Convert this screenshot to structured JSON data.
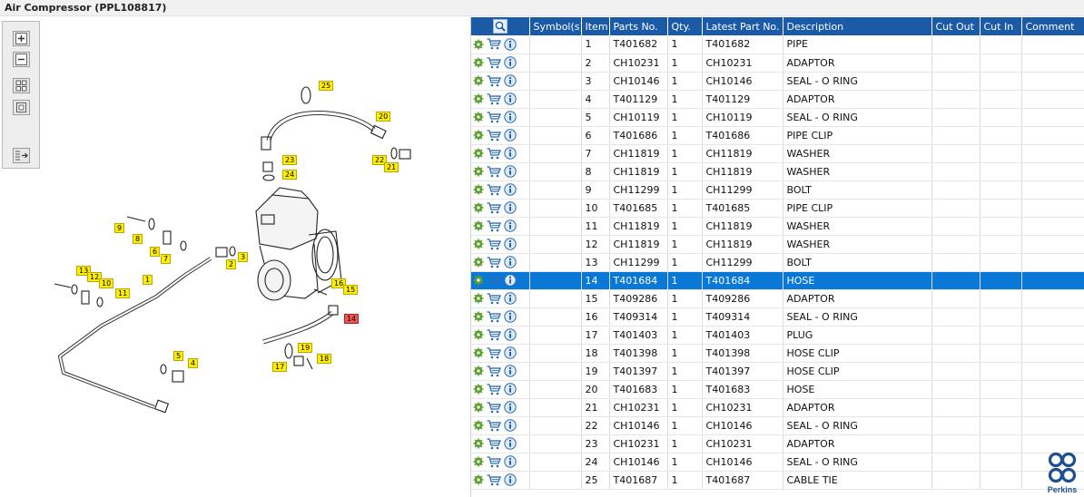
{
  "window": {
    "title": "Air Compressor (PPL108817)"
  },
  "toolbar": {
    "buttons": [
      {
        "name": "zoom-in-icon"
      },
      {
        "name": "zoom-out-icon"
      },
      {
        "name": "fit-all-icon"
      },
      {
        "name": "fit-window-icon"
      },
      {
        "name": "list-export-icon"
      }
    ]
  },
  "grid": {
    "headers": {
      "symbols": "Symbol(s)",
      "item": "Item",
      "parts_no": "Parts No.",
      "qty": "Qty.",
      "latest_part_no": "Latest Part No.",
      "description": "Description",
      "cut_out": "Cut Out",
      "cut_in": "Cut In",
      "comment": "Comment"
    },
    "selected_item": "14",
    "rows": [
      {
        "item": "1",
        "parts_no": "T401682",
        "qty": "1",
        "latest": "T401682",
        "desc": "PIPE"
      },
      {
        "item": "2",
        "parts_no": "CH10231",
        "qty": "1",
        "latest": "CH10231",
        "desc": "ADAPTOR"
      },
      {
        "item": "3",
        "parts_no": "CH10146",
        "qty": "1",
        "latest": "CH10146",
        "desc": "SEAL - O RING"
      },
      {
        "item": "4",
        "parts_no": "T401129",
        "qty": "1",
        "latest": "T401129",
        "desc": "ADAPTOR"
      },
      {
        "item": "5",
        "parts_no": "CH10119",
        "qty": "1",
        "latest": "CH10119",
        "desc": "SEAL - O RING"
      },
      {
        "item": "6",
        "parts_no": "T401686",
        "qty": "1",
        "latest": "T401686",
        "desc": "PIPE CLIP"
      },
      {
        "item": "7",
        "parts_no": "CH11819",
        "qty": "1",
        "latest": "CH11819",
        "desc": "WASHER"
      },
      {
        "item": "8",
        "parts_no": "CH11819",
        "qty": "1",
        "latest": "CH11819",
        "desc": "WASHER"
      },
      {
        "item": "9",
        "parts_no": "CH11299",
        "qty": "1",
        "latest": "CH11299",
        "desc": "BOLT"
      },
      {
        "item": "10",
        "parts_no": "T401685",
        "qty": "1",
        "latest": "T401685",
        "desc": "PIPE CLIP"
      },
      {
        "item": "11",
        "parts_no": "CH11819",
        "qty": "1",
        "latest": "CH11819",
        "desc": "WASHER"
      },
      {
        "item": "12",
        "parts_no": "CH11819",
        "qty": "1",
        "latest": "CH11819",
        "desc": "WASHER"
      },
      {
        "item": "13",
        "parts_no": "CH11299",
        "qty": "1",
        "latest": "CH11299",
        "desc": "BOLT"
      },
      {
        "item": "14",
        "parts_no": "T401684",
        "qty": "1",
        "latest": "T401684",
        "desc": "HOSE"
      },
      {
        "item": "15",
        "parts_no": "T409286",
        "qty": "1",
        "latest": "T409286",
        "desc": "ADAPTOR"
      },
      {
        "item": "16",
        "parts_no": "T409314",
        "qty": "1",
        "latest": "T409314",
        "desc": "SEAL - O RING"
      },
      {
        "item": "17",
        "parts_no": "T401403",
        "qty": "1",
        "latest": "T401403",
        "desc": "PLUG"
      },
      {
        "item": "18",
        "parts_no": "T401398",
        "qty": "1",
        "latest": "T401398",
        "desc": "HOSE CLIP"
      },
      {
        "item": "19",
        "parts_no": "T401397",
        "qty": "1",
        "latest": "T401397",
        "desc": "HOSE CLIP"
      },
      {
        "item": "20",
        "parts_no": "T401683",
        "qty": "1",
        "latest": "T401683",
        "desc": "HOSE"
      },
      {
        "item": "21",
        "parts_no": "CH10231",
        "qty": "1",
        "latest": "CH10231",
        "desc": "ADAPTOR"
      },
      {
        "item": "22",
        "parts_no": "CH10146",
        "qty": "1",
        "latest": "CH10146",
        "desc": "SEAL - O RING"
      },
      {
        "item": "23",
        "parts_no": "CH10231",
        "qty": "1",
        "latest": "CH10231",
        "desc": "ADAPTOR"
      },
      {
        "item": "24",
        "parts_no": "CH10146",
        "qty": "1",
        "latest": "CH10146",
        "desc": "SEAL - O RING"
      },
      {
        "item": "25",
        "parts_no": "T401687",
        "qty": "1",
        "latest": "T401687",
        "desc": "CABLE TIE"
      }
    ]
  },
  "diagram": {
    "callouts": [
      "25",
      "20",
      "23",
      "24",
      "22",
      "21",
      "9",
      "8",
      "6",
      "7",
      "2",
      "3",
      "13",
      "12",
      "10",
      "11",
      "1",
      "16",
      "15",
      "14",
      "5",
      "4",
      "19",
      "17",
      "18"
    ],
    "selected_callout": "14"
  },
  "logo": {
    "brand": "Perkins"
  },
  "colors": {
    "header_blue": "#1b5aa6",
    "selected_row": "#0a78d7",
    "callout_yellow": "#ffee00",
    "callout_selected": "#ee5555"
  }
}
